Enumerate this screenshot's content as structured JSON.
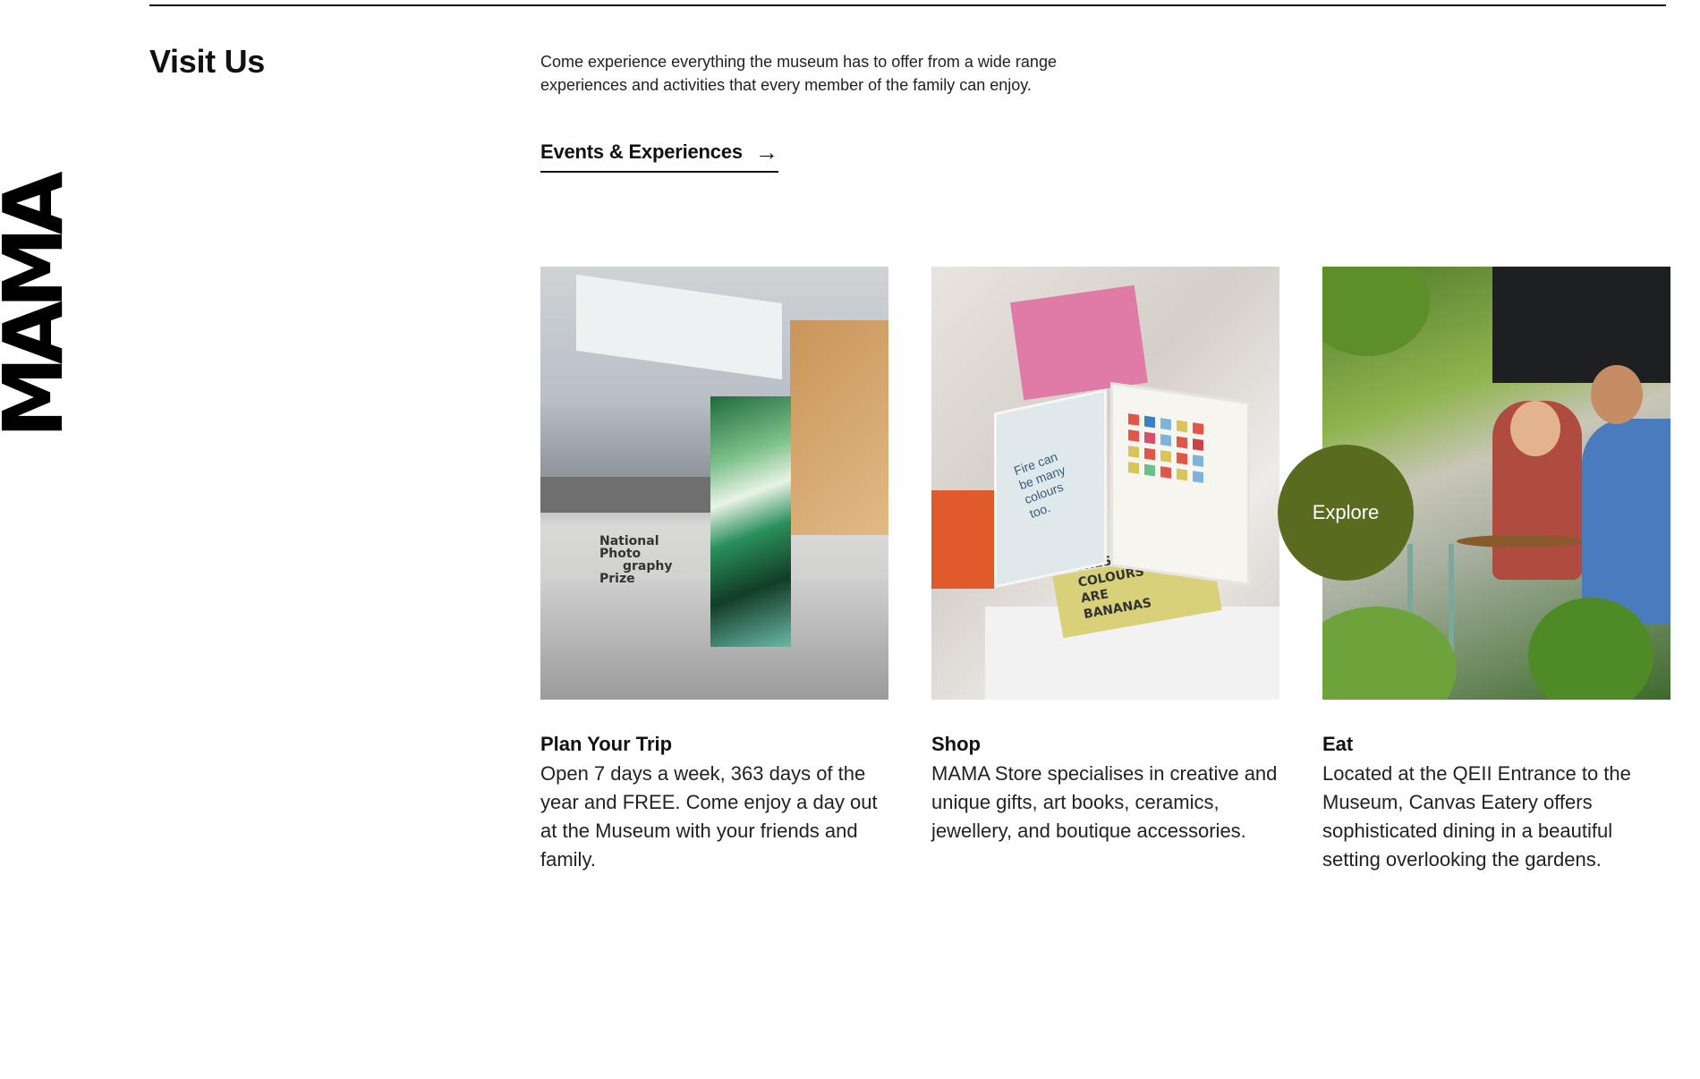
{
  "logo": {
    "text": "MAMA"
  },
  "section": {
    "title": "Visit Us",
    "intro": "Come experience everything the museum has to offer from a wide range experiences and activities that every member of the family can enjoy.",
    "cta_label": "Events & Experiences",
    "cta_icon": "arrow-right-icon"
  },
  "cards": [
    {
      "title": "Plan Your Trip",
      "text": "Open 7 days a week, 363 days of the year and FREE. Come enjoy a day out at the Museum with your friends and family.",
      "image_text": [
        "National",
        "Photo",
        "graphy",
        "Prize"
      ]
    },
    {
      "title": "Shop",
      "text": "MAMA Store specialises in creative and unique gifts, art books, ceramics, jewellery, and boutique accessories.",
      "image_text": {
        "cover": [
          "THESE",
          "COLOURS",
          "ARE",
          "BANANAS"
        ],
        "page": [
          "Fire can",
          "be many",
          "colours",
          "too."
        ]
      }
    },
    {
      "title": "Eat",
      "text": "Located at the QEII Entrance to the Museum, Canvas Eatery offers sophisticated dining in a beautiful setting overlooking the gardens."
    }
  ],
  "explore_label": "Explore",
  "colors": {
    "accent": "#586b1f",
    "text": "#111111",
    "background": "#ffffff"
  }
}
